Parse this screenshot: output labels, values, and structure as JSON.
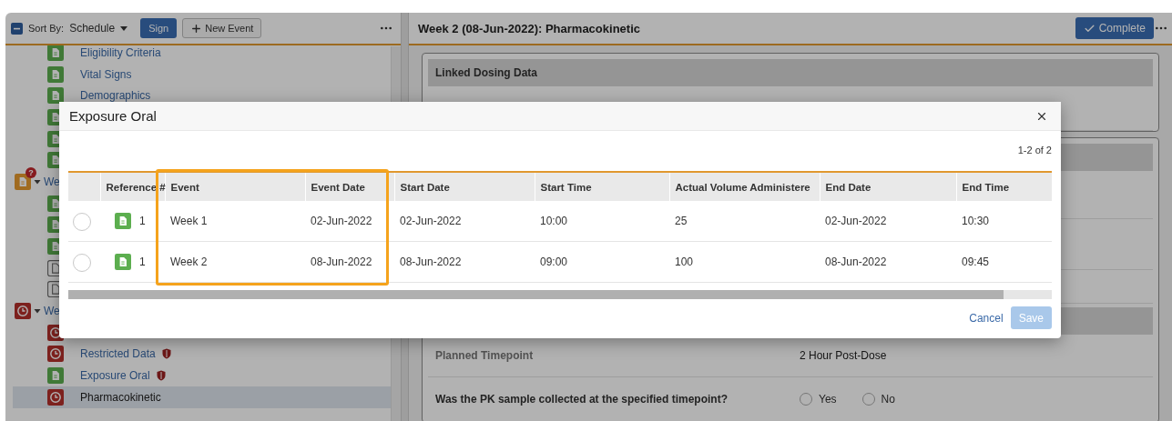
{
  "sidebar": {
    "toolbar": {
      "sort_label": "Sort By:",
      "sort_value": "Schedule",
      "sign_button": "Sign",
      "new_event_button": "New Event"
    },
    "leading_items": [
      {
        "kind": "form",
        "label": "Eligibility Criteria",
        "restricted": false,
        "selected": false
      },
      {
        "kind": "form",
        "label": "Vital Signs",
        "restricted": false,
        "selected": false
      },
      {
        "kind": "form",
        "label": "Demographics",
        "restricted": false,
        "selected": false
      },
      {
        "kind": "form",
        "selected": false
      },
      {
        "kind": "form",
        "selected": false
      },
      {
        "kind": "form",
        "selected": false
      }
    ],
    "events": [
      {
        "kind": "query-form",
        "badge": "?",
        "label": "We",
        "expanded": true,
        "selected": false,
        "children": [
          {
            "kind": "form",
            "selected": false
          },
          {
            "kind": "form",
            "selected": false
          },
          {
            "kind": "form",
            "selected": false
          },
          {
            "kind": "empty-form",
            "selected": false
          },
          {
            "kind": "empty-form",
            "selected": false
          }
        ]
      },
      {
        "kind": "overdue",
        "label": "We",
        "expanded": true,
        "selected": false,
        "children": [
          {
            "kind": "overdue",
            "selected": false
          },
          {
            "kind": "overdue",
            "label": "Restricted Data",
            "restricted": true,
            "selected": false
          },
          {
            "kind": "form",
            "label": "Exposure Oral",
            "restricted": true,
            "selected": false
          },
          {
            "kind": "overdue",
            "label": "Pharmacokinetic",
            "restricted": false,
            "selected": true
          }
        ]
      }
    ]
  },
  "detail": {
    "title": "Week 2 (08-Jun-2022): Pharmacokinetic",
    "complete_button": "Complete",
    "linked_section": "Linked Dosing Data",
    "planned_label": "Planned Timepoint",
    "planned_value": "2 Hour Post-Dose",
    "question": {
      "text": "Was the PK sample collected at the specified timepoint?",
      "options": [
        {
          "label": "Yes",
          "selected": false
        },
        {
          "label": "No",
          "selected": false
        }
      ]
    }
  },
  "dialog": {
    "title": "Exposure Oral",
    "pager": "1-2 of 2",
    "columns": [
      "Reference #",
      "Event",
      "Event Date",
      "Start Date",
      "Start Time",
      "Actual Volume Administere",
      "End Date",
      "End Time"
    ],
    "rows": [
      {
        "selected": false,
        "cells": [
          "1",
          "Week 1",
          "02-Jun-2022",
          "02-Jun-2022",
          "10:00",
          "25",
          "02-Jun-2022",
          "10:30"
        ]
      },
      {
        "selected": false,
        "cells": [
          "1",
          "Week 2",
          "08-Jun-2022",
          "08-Jun-2022",
          "09:00",
          "100",
          "08-Jun-2022",
          "09:45"
        ]
      }
    ],
    "cancel_button": "Cancel",
    "save_button": {
      "label": "Save",
      "disabled": true
    }
  }
}
